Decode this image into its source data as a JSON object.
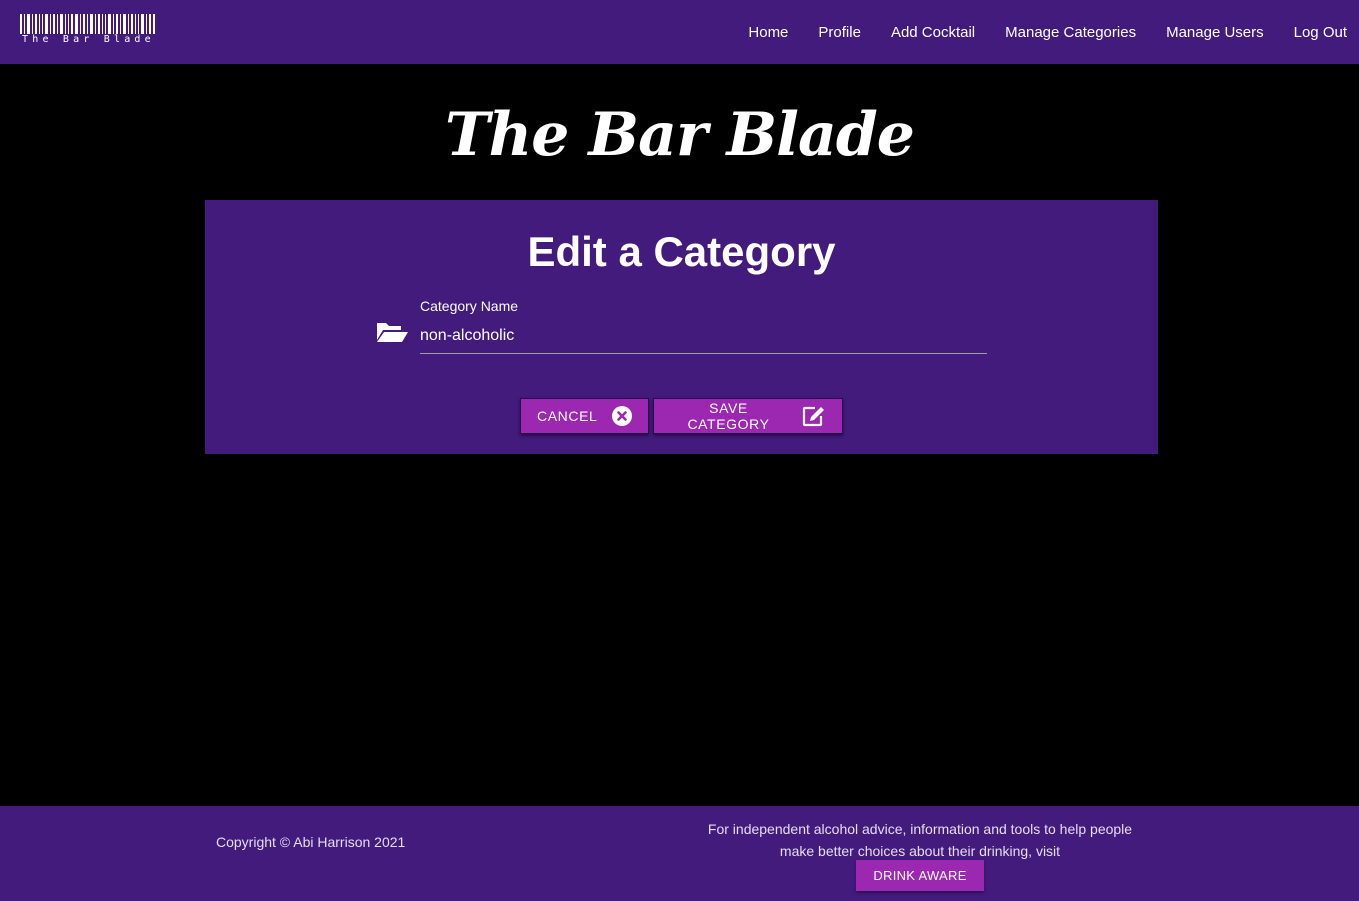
{
  "brand": {
    "logo_text": "The Bar Blade"
  },
  "nav": {
    "items": [
      {
        "label": "Home"
      },
      {
        "label": "Profile"
      },
      {
        "label": "Add Cocktail"
      },
      {
        "label": "Manage Categories"
      },
      {
        "label": "Manage Users"
      },
      {
        "label": "Log Out"
      }
    ]
  },
  "hero": {
    "title": "The Bar Blade"
  },
  "form": {
    "title": "Edit a Category",
    "field_label": "Category Name",
    "field_value": "non-alcoholic",
    "field_icon": "folder-open-icon",
    "cancel_label": "Cancel",
    "cancel_icon": "times-circle-icon",
    "save_label": "Save Category",
    "save_icon": "edit-icon"
  },
  "footer": {
    "copyright": "Copyright © Abi Harrison 2021",
    "advice": "For independent alcohol advice, information and tools to help people make better choices about their drinking, visit",
    "drink_aware_label": "DRINK AWARE"
  },
  "colors": {
    "primary_purple": "#421b7c",
    "button_purple": "#9c27b0",
    "background": "#000000"
  }
}
